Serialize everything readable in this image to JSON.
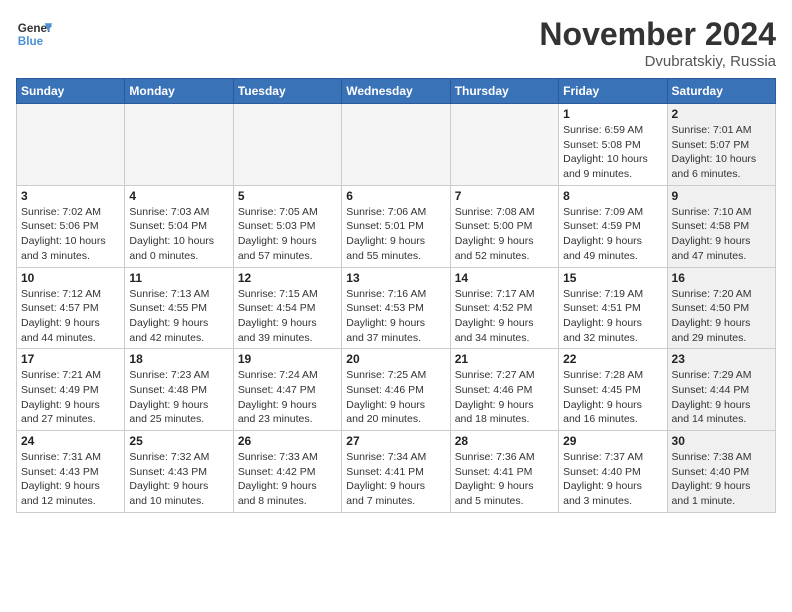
{
  "logo": {
    "line1": "General",
    "line2": "Blue"
  },
  "title": "November 2024",
  "location": "Dvubratskiy, Russia",
  "weekdays": [
    "Sunday",
    "Monday",
    "Tuesday",
    "Wednesday",
    "Thursday",
    "Friday",
    "Saturday"
  ],
  "weeks": [
    [
      {
        "day": "",
        "info": "",
        "empty": true
      },
      {
        "day": "",
        "info": "",
        "empty": true
      },
      {
        "day": "",
        "info": "",
        "empty": true
      },
      {
        "day": "",
        "info": "",
        "empty": true
      },
      {
        "day": "",
        "info": "",
        "empty": true
      },
      {
        "day": "1",
        "info": "Sunrise: 6:59 AM\nSunset: 5:08 PM\nDaylight: 10 hours\nand 9 minutes.",
        "shaded": false
      },
      {
        "day": "2",
        "info": "Sunrise: 7:01 AM\nSunset: 5:07 PM\nDaylight: 10 hours\nand 6 minutes.",
        "shaded": true
      }
    ],
    [
      {
        "day": "3",
        "info": "Sunrise: 7:02 AM\nSunset: 5:06 PM\nDaylight: 10 hours\nand 3 minutes.",
        "shaded": false
      },
      {
        "day": "4",
        "info": "Sunrise: 7:03 AM\nSunset: 5:04 PM\nDaylight: 10 hours\nand 0 minutes.",
        "shaded": false
      },
      {
        "day": "5",
        "info": "Sunrise: 7:05 AM\nSunset: 5:03 PM\nDaylight: 9 hours\nand 57 minutes.",
        "shaded": false
      },
      {
        "day": "6",
        "info": "Sunrise: 7:06 AM\nSunset: 5:01 PM\nDaylight: 9 hours\nand 55 minutes.",
        "shaded": false
      },
      {
        "day": "7",
        "info": "Sunrise: 7:08 AM\nSunset: 5:00 PM\nDaylight: 9 hours\nand 52 minutes.",
        "shaded": false
      },
      {
        "day": "8",
        "info": "Sunrise: 7:09 AM\nSunset: 4:59 PM\nDaylight: 9 hours\nand 49 minutes.",
        "shaded": false
      },
      {
        "day": "9",
        "info": "Sunrise: 7:10 AM\nSunset: 4:58 PM\nDaylight: 9 hours\nand 47 minutes.",
        "shaded": true
      }
    ],
    [
      {
        "day": "10",
        "info": "Sunrise: 7:12 AM\nSunset: 4:57 PM\nDaylight: 9 hours\nand 44 minutes.",
        "shaded": false
      },
      {
        "day": "11",
        "info": "Sunrise: 7:13 AM\nSunset: 4:55 PM\nDaylight: 9 hours\nand 42 minutes.",
        "shaded": false
      },
      {
        "day": "12",
        "info": "Sunrise: 7:15 AM\nSunset: 4:54 PM\nDaylight: 9 hours\nand 39 minutes.",
        "shaded": false
      },
      {
        "day": "13",
        "info": "Sunrise: 7:16 AM\nSunset: 4:53 PM\nDaylight: 9 hours\nand 37 minutes.",
        "shaded": false
      },
      {
        "day": "14",
        "info": "Sunrise: 7:17 AM\nSunset: 4:52 PM\nDaylight: 9 hours\nand 34 minutes.",
        "shaded": false
      },
      {
        "day": "15",
        "info": "Sunrise: 7:19 AM\nSunset: 4:51 PM\nDaylight: 9 hours\nand 32 minutes.",
        "shaded": false
      },
      {
        "day": "16",
        "info": "Sunrise: 7:20 AM\nSunset: 4:50 PM\nDaylight: 9 hours\nand 29 minutes.",
        "shaded": true
      }
    ],
    [
      {
        "day": "17",
        "info": "Sunrise: 7:21 AM\nSunset: 4:49 PM\nDaylight: 9 hours\nand 27 minutes.",
        "shaded": false
      },
      {
        "day": "18",
        "info": "Sunrise: 7:23 AM\nSunset: 4:48 PM\nDaylight: 9 hours\nand 25 minutes.",
        "shaded": false
      },
      {
        "day": "19",
        "info": "Sunrise: 7:24 AM\nSunset: 4:47 PM\nDaylight: 9 hours\nand 23 minutes.",
        "shaded": false
      },
      {
        "day": "20",
        "info": "Sunrise: 7:25 AM\nSunset: 4:46 PM\nDaylight: 9 hours\nand 20 minutes.",
        "shaded": false
      },
      {
        "day": "21",
        "info": "Sunrise: 7:27 AM\nSunset: 4:46 PM\nDaylight: 9 hours\nand 18 minutes.",
        "shaded": false
      },
      {
        "day": "22",
        "info": "Sunrise: 7:28 AM\nSunset: 4:45 PM\nDaylight: 9 hours\nand 16 minutes.",
        "shaded": false
      },
      {
        "day": "23",
        "info": "Sunrise: 7:29 AM\nSunset: 4:44 PM\nDaylight: 9 hours\nand 14 minutes.",
        "shaded": true
      }
    ],
    [
      {
        "day": "24",
        "info": "Sunrise: 7:31 AM\nSunset: 4:43 PM\nDaylight: 9 hours\nand 12 minutes.",
        "shaded": false
      },
      {
        "day": "25",
        "info": "Sunrise: 7:32 AM\nSunset: 4:43 PM\nDaylight: 9 hours\nand 10 minutes.",
        "shaded": false
      },
      {
        "day": "26",
        "info": "Sunrise: 7:33 AM\nSunset: 4:42 PM\nDaylight: 9 hours\nand 8 minutes.",
        "shaded": false
      },
      {
        "day": "27",
        "info": "Sunrise: 7:34 AM\nSunset: 4:41 PM\nDaylight: 9 hours\nand 7 minutes.",
        "shaded": false
      },
      {
        "day": "28",
        "info": "Sunrise: 7:36 AM\nSunset: 4:41 PM\nDaylight: 9 hours\nand 5 minutes.",
        "shaded": false
      },
      {
        "day": "29",
        "info": "Sunrise: 7:37 AM\nSunset: 4:40 PM\nDaylight: 9 hours\nand 3 minutes.",
        "shaded": false
      },
      {
        "day": "30",
        "info": "Sunrise: 7:38 AM\nSunset: 4:40 PM\nDaylight: 9 hours\nand 1 minute.",
        "shaded": true
      }
    ]
  ]
}
